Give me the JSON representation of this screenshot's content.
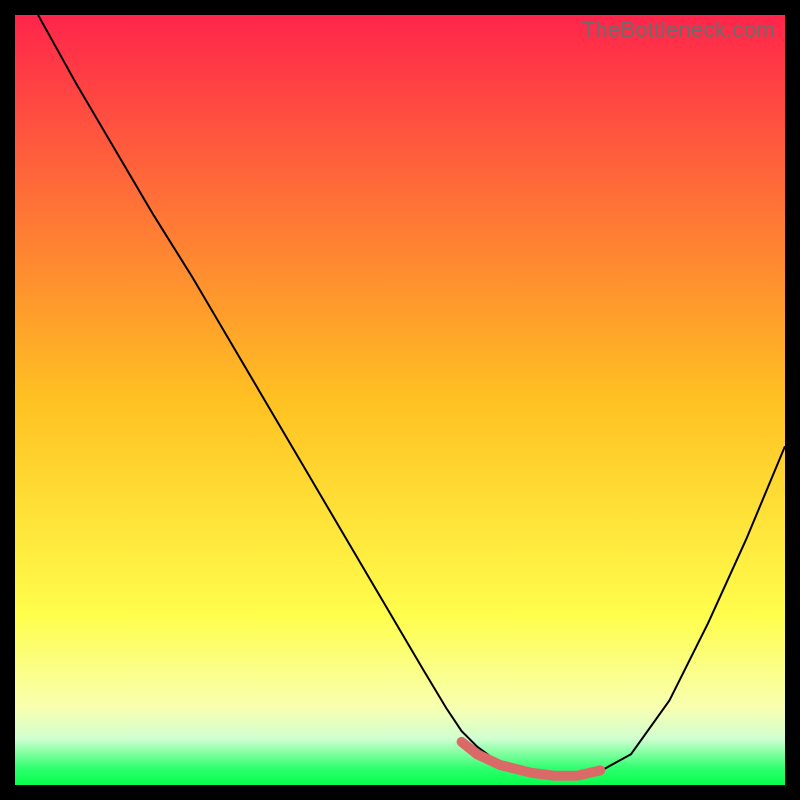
{
  "watermark": "TheBottleneck.com",
  "chart_data": {
    "type": "line",
    "title": "",
    "xlabel": "",
    "ylabel": "",
    "xlim": [
      0,
      100
    ],
    "ylim": [
      0,
      100
    ],
    "background_gradient": {
      "stops": [
        {
          "offset": 0.0,
          "color": "#ff254b"
        },
        {
          "offset": 0.5,
          "color": "#ffc122"
        },
        {
          "offset": 0.78,
          "color": "#fffe4c"
        },
        {
          "offset": 0.9,
          "color": "#f8ffb1"
        },
        {
          "offset": 0.94,
          "color": "#d0ffd0"
        },
        {
          "offset": 0.98,
          "color": "#29ff6b"
        },
        {
          "offset": 1.0,
          "color": "#07ff4b"
        }
      ]
    },
    "series": [
      {
        "name": "bottleneck-curve",
        "color": "#000000",
        "stroke_width": 2,
        "type": "line",
        "x": [
          3,
          8,
          13,
          18,
          23,
          28,
          33,
          38,
          43,
          48,
          53,
          56,
          58,
          60,
          63,
          67,
          70,
          73,
          76,
          80,
          85,
          90,
          95,
          100
        ],
        "y": [
          100,
          91,
          82.5,
          74,
          66,
          57.5,
          49,
          40.5,
          32,
          23.5,
          15,
          10,
          7,
          5,
          2.8,
          1.6,
          1.2,
          1.2,
          1.8,
          4,
          11,
          21,
          32,
          44
        ]
      },
      {
        "name": "optimal-segment",
        "color": "#da6a67",
        "stroke_width": 10,
        "linecap": "round",
        "type": "line",
        "x": [
          58,
          60,
          63,
          67,
          70,
          73,
          76
        ],
        "y": [
          5.6,
          4.0,
          2.6,
          1.6,
          1.2,
          1.2,
          1.9
        ]
      }
    ]
  }
}
